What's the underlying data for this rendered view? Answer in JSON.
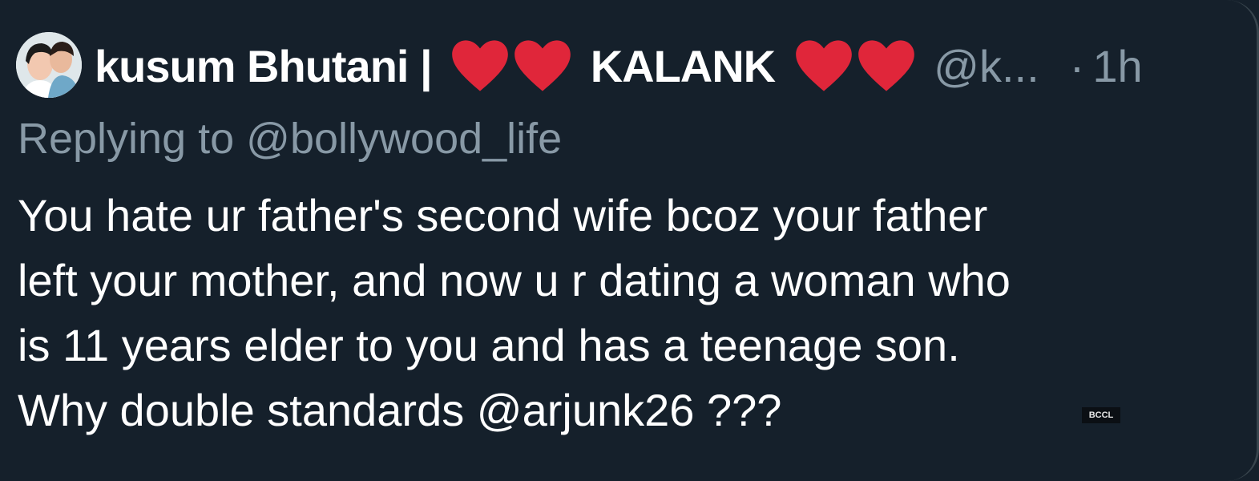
{
  "tweet": {
    "display_name": {
      "first": "kusum Bhutani |",
      "middle": "KALANK",
      "heart_color": "#e0263a"
    },
    "handle": "@k...",
    "separator": "·",
    "timestamp": "1h",
    "replying_prefix": "Replying to ",
    "replying_to": "@bollywood_life",
    "text_lines": [
      "You hate ur father's second wife bcoz your father",
      "left your mother, and now u r dating a woman who",
      "is 11 years elder to you and has a teenage son.",
      "Why double standards "
    ],
    "text_mention": "@arjunk26",
    "text_suffix": " ???"
  },
  "watermark": "BCCL",
  "colors": {
    "background": "#15202b",
    "primary_text": "#ffffff",
    "secondary_text": "#8899a6"
  }
}
